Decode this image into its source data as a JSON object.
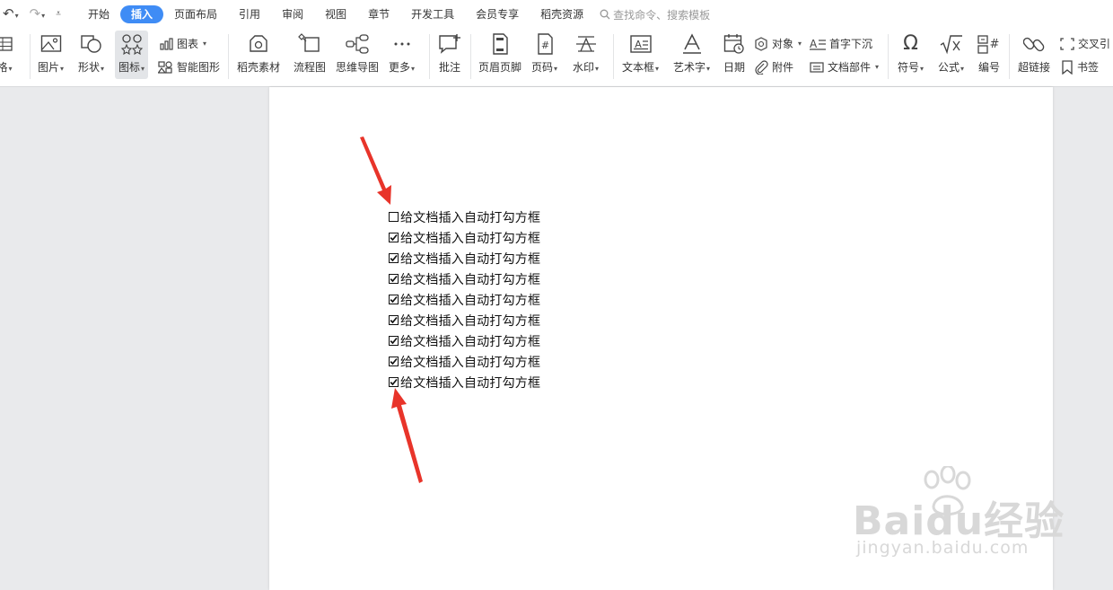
{
  "quick_access": [
    "undo-icon",
    "redo-icon",
    "customize-icon"
  ],
  "tabs": [
    {
      "label": "开始",
      "active": false
    },
    {
      "label": "插入",
      "active": true
    },
    {
      "label": "页面布局",
      "active": false
    },
    {
      "label": "引用",
      "active": false
    },
    {
      "label": "审阅",
      "active": false
    },
    {
      "label": "视图",
      "active": false
    },
    {
      "label": "章节",
      "active": false
    },
    {
      "label": "开发工具",
      "active": false
    },
    {
      "label": "会员专享",
      "active": false
    },
    {
      "label": "稻壳资源",
      "active": false
    }
  ],
  "search": {
    "placeholder": "查找命令、搜索模板"
  },
  "ribbon": {
    "table": "格",
    "picture": "图片",
    "shape": "形状",
    "icon": "图标",
    "chart": "图表",
    "smart_art": "智能图形",
    "daoke_material": "稻壳素材",
    "flowchart": "流程图",
    "mindmap": "思维导图",
    "more": "更多",
    "comment": "批注",
    "header_footer": "页眉页脚",
    "page_number": "页码",
    "watermark": "水印",
    "textbox": "文本框",
    "wordart": "艺术字",
    "date": "日期",
    "object": "对象",
    "attachment": "附件",
    "drop_cap": "首字下沉",
    "doc_parts": "文档部件",
    "symbol": "符号",
    "formula": "公式",
    "numbering": "编号",
    "hyperlink": "超链接",
    "cross_ref": "交叉引",
    "bookmark": "书签"
  },
  "document": {
    "lines": [
      {
        "text": "给文档插入自动打勾方框",
        "checked": false
      },
      {
        "text": "给文档插入自动打勾方框",
        "checked": true
      },
      {
        "text": "给文档插入自动打勾方框",
        "checked": true
      },
      {
        "text": "给文档插入自动打勾方框",
        "checked": true
      },
      {
        "text": "给文档插入自动打勾方框",
        "checked": true
      },
      {
        "text": "给文档插入自动打勾方框",
        "checked": true
      },
      {
        "text": "给文档插入自动打勾方框",
        "checked": true
      },
      {
        "text": "给文档插入自动打勾方框",
        "checked": true
      },
      {
        "text": "给文档插入自动打勾方框",
        "checked": true
      }
    ]
  },
  "watermark": {
    "brand": "Baidu经验",
    "url": "jingyan.baidu.com"
  },
  "colors": {
    "accent": "#3f8cf5",
    "arrow": "#e8342a"
  }
}
